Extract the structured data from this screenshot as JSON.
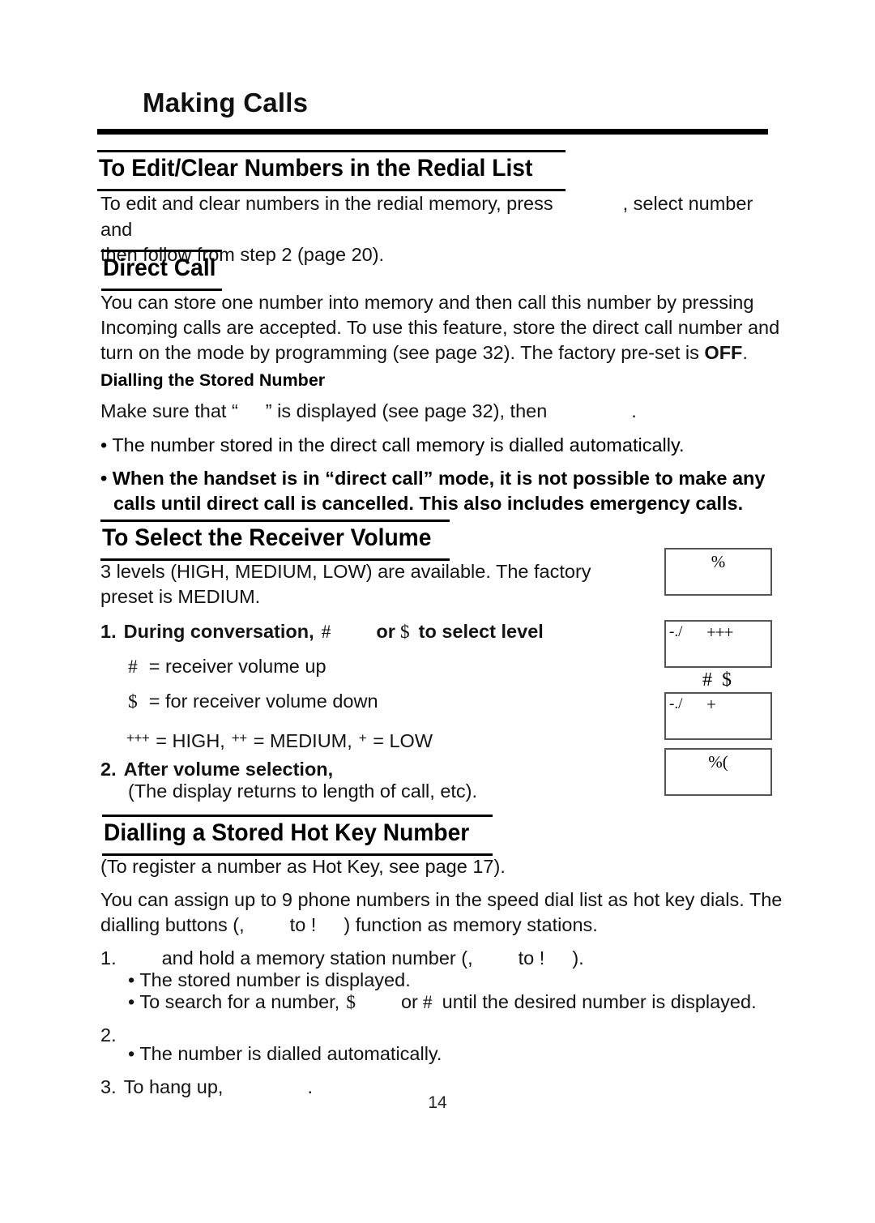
{
  "document": {
    "title": "Making Calls",
    "page_number": "14"
  },
  "sections": [
    {
      "id": "redial",
      "heading": "To Edit/Clear Numbers in the Redial List",
      "paragraph_a": "To edit and clear numbers in the redial memory, press",
      "paragraph_b": ", select number and",
      "paragraph_c": "then follow from step 2 (page 20)."
    },
    {
      "id": "direct-call",
      "heading": "Direct Call",
      "para1_a": "You can store one number into memory and then call this number by pressing",
      "para1_b": ".",
      "para2": "Incoming calls are accepted. To use this feature, store the direct call number and",
      "para3_a": "turn on the mode by programming (see page 32). The factory pre-set is ",
      "para3_bold": "OFF",
      "para3_b": ".",
      "subheading": "Dialling the Stored Number",
      "make_sure_a": "Make sure that “",
      "make_sure_b": "” is displayed (see page 32), then",
      "make_sure_c": ".",
      "bullet1": "• The number stored in the direct call memory is dialled automatically.",
      "bullet2_line1": "• When the handset is in “direct call” mode, it is not possible to make any",
      "bullet2_line2": "calls until direct call is cancelled. This also includes emergency calls."
    },
    {
      "id": "receiver-volume",
      "heading": "To Select the Receiver Volume",
      "intro_line1": "3 levels (HIGH, MEDIUM, LOW) are available. The factory",
      "intro_line2": "preset is MEDIUM.",
      "step1_number": "1.",
      "step1_a": "During conversation,",
      "step1_sym_up": "#",
      "step1_b": "or",
      "step1_sym_down": "$",
      "step1_c": "to select level",
      "note_up_sym": "#",
      "note_up_text": "= receiver volume up",
      "note_down_sym": "$",
      "note_down_text": "= for receiver volume down",
      "levels_high_sym": "+++",
      "levels_high_text": "= HIGH,",
      "levels_medium_sym": "++",
      "levels_medium_text": "= MEDIUM,",
      "levels_low_sym": "+",
      "levels_low_text": "= LOW",
      "step2_number": "2.",
      "step2_a": "After volume selection,",
      "step2_b": "(The display returns to length of call, etc)."
    },
    {
      "id": "hot-key",
      "heading": "Dialling a Stored Hot Key Number",
      "note": "(To register a number as Hot Key, see page 17).",
      "para_line1": "You can assign up to 9 phone numbers in the speed dial list as hot key dials. The",
      "para_line2_a": "dialling buttons (,",
      "para_line2_b": "to !",
      "para_line2_c": ") function as memory stations.",
      "step1_number": "1.",
      "step1_a": "and hold a memory station number (,",
      "step1_b": "to !",
      "step1_c": ").",
      "step1_bullet1": "• The stored number is displayed.",
      "step1_bullet2_a": "• To search for a number,",
      "step1_bullet2_sym1": "$",
      "step1_bullet2_mid": "or",
      "step1_bullet2_sym2": "#",
      "step1_bullet2_b": "until the desired number is displayed.",
      "step2_number": "2.",
      "step2_bullet": "• The number is dialled automatically.",
      "step3_number": "3.",
      "step3_text": "To hang up,",
      "step3_end": "."
    }
  ],
  "lcd_displays": [
    {
      "id": "lcd-1",
      "left": "",
      "center": "%",
      "mid": ""
    },
    {
      "id": "lcd-2",
      "left": "-./",
      "center": "",
      "mid": "+++"
    },
    {
      "id": "lcd-3",
      "left": "-./",
      "center": "",
      "mid": "+"
    },
    {
      "id": "lcd-4",
      "left": "",
      "center": "%(",
      "mid": ""
    }
  ],
  "lcd_key_labels": "# $",
  "colors": {
    "ink": "#101010",
    "rule": "#000000",
    "lcd_border": "#555555",
    "page": "#ffffff"
  }
}
